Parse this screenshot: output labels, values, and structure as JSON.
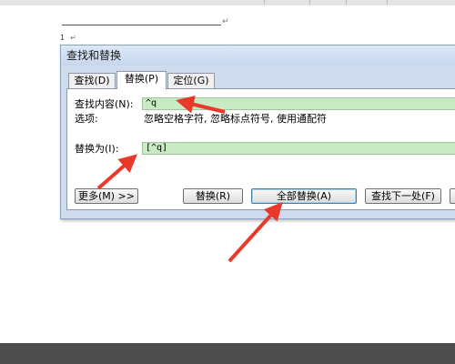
{
  "dialog": {
    "title": "查找和替换",
    "tabs": [
      {
        "label": "查找(D)"
      },
      {
        "label": "替换(P)"
      },
      {
        "label": "定位(G)"
      }
    ],
    "find_label": "查找内容(N):",
    "find_value": "^q",
    "options_label": "选项:",
    "options_value": "忽略空格字符, 忽略标点符号, 使用通配符",
    "replace_label": "替换为(I):",
    "replace_value": "[^q]",
    "buttons": {
      "more": "更多(M) >>",
      "replace": "替换(R)",
      "replace_all": "全部替换(A)",
      "find_next": "查找下一处(F)"
    }
  },
  "document": {
    "paragraph_mark": "↵",
    "footnote_number": "1"
  },
  "annotation_color": "#e8392a"
}
